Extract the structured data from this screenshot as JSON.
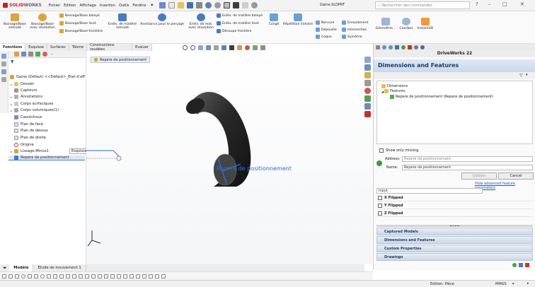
{
  "app": {
    "brand_red": "SOLID",
    "brand_grey": "WORKS",
    "file_name": "Gaine.SLDPRT",
    "search_placeholder": "Rechercher des commandes"
  },
  "menu": [
    "Fichier",
    "Edition",
    "Affichage",
    "Insertion",
    "Outils",
    "Fenêtre"
  ],
  "ribbon": {
    "boss_extrude": [
      "Bossage/Base",
      "extrudé"
    ],
    "boss_revolve": [
      "Bossage/Base",
      "avec révolution"
    ],
    "small_left": [
      "Bossage/Base balayé",
      "Bossage/Base lissé",
      "Bossage/Base frontière"
    ],
    "cut_extrude": [
      "Enlèv. de matière",
      "extrudé"
    ],
    "assistance": [
      "Assistance pour le perçage"
    ],
    "cut_revolve": [
      "Enlèv. de mat.",
      "avec révolution"
    ],
    "small_mid": [
      "Enlèv. de matière balayé",
      "Enlèv. de matière lissé",
      "Découpe frontière"
    ],
    "conge": [
      "Congé"
    ],
    "repetition": [
      "Répétition linéaire"
    ],
    "small_r1": [
      "Nervure",
      "Dépouille",
      "Coque"
    ],
    "small_r2": [
      "Enroulement",
      "Intersection",
      "Symétrie"
    ],
    "geometrie": [
      "Géométrie..."
    ],
    "courbes": [
      "Courbes"
    ],
    "instant3d": [
      "Instant3D"
    ]
  },
  "tabs": [
    "Fonctions",
    "Esquisse",
    "Surfaces",
    "Tôlerie",
    "Constructions soudées",
    "Evaluer"
  ],
  "tree": {
    "root": "Gaine (Défaut) <<Défaut>_Etat d'aff",
    "items": [
      "Dossier",
      "Capteurs",
      "Annotations",
      "Corps surfaciques",
      "Corps volumiques(1)",
      "Caoutchouc",
      "Plan de face",
      "Plan de dessus",
      "Plan de droite",
      "Origine",
      "Lissage-Mince1",
      "Repere de positionnement"
    ],
    "tooltip": "Esquisse1"
  },
  "viewport": {
    "breadcrumb": "Repere de positionnement",
    "label_3d": "Repere de positionnement"
  },
  "driveworks": {
    "panel_title": "DriveWorks 22",
    "header": "Dimensions and Features",
    "tree": [
      "Dimensions",
      "Features",
      "Repere de positionnement (Repere de positionnement)"
    ],
    "show_only_missing": "Show only missing",
    "address_label": "Address:",
    "address_placeholder": "Repere de positionnement",
    "name_label": "Name:",
    "name_value": "Repere de positionnement",
    "update_btn": "Update",
    "cancel_btn": "Cancel",
    "hide_link": "Hide advanced feature parameters",
    "input_label": "Input",
    "flips": [
      "X Flipped",
      "Y Flipped",
      "Z Flipped"
    ],
    "sections": [
      "Captured Models",
      "Dimensions and Features",
      "Custom Properties",
      "Drawings"
    ]
  },
  "model_tabs": [
    "Modèle",
    "Etude de mouvement 1"
  ],
  "status": {
    "edition": "Edition: Pièce",
    "units": "MMGS"
  },
  "colors": {
    "accent": "#1f5fbf",
    "brand": "#d71920",
    "panel_header": "#c8d8ee"
  }
}
